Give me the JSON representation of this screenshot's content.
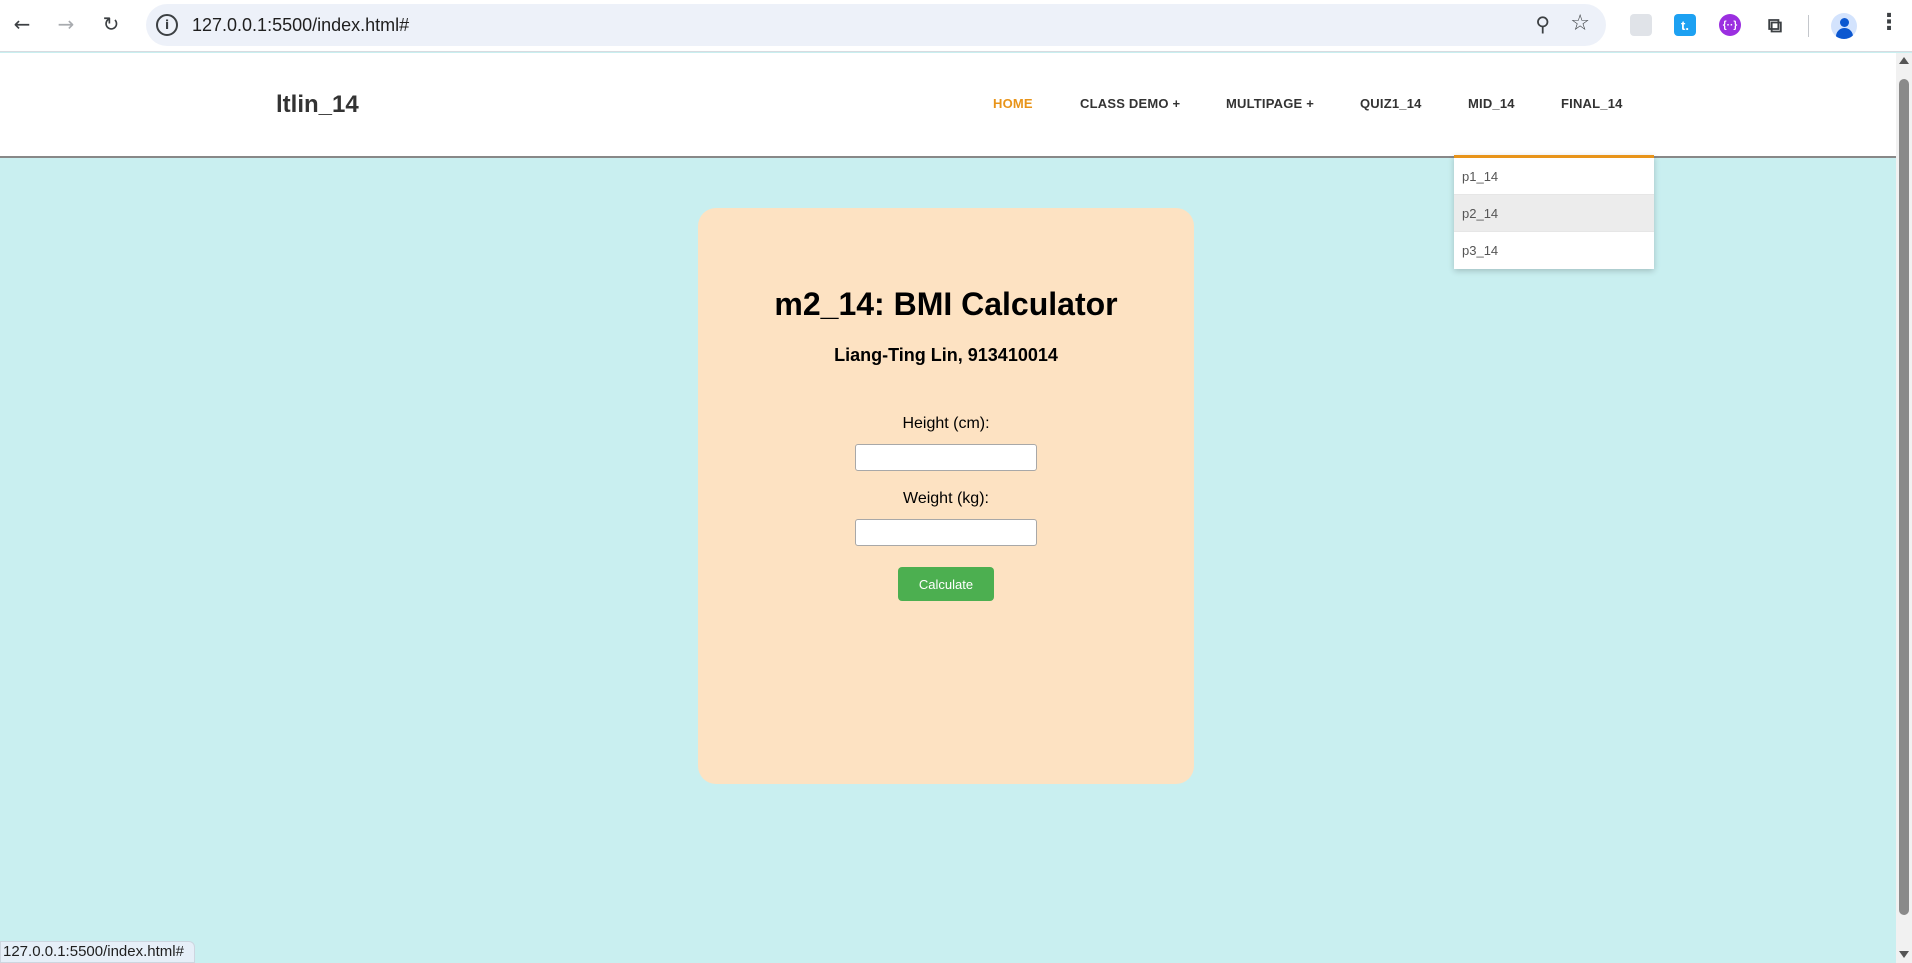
{
  "browser": {
    "url": "127.0.0.1:5500/index.html#",
    "status_url": "127.0.0.1:5500/index.html#",
    "extensions": [
      "generic-extension",
      "t-extension",
      "purple-extension"
    ],
    "extension_blue_letter": "t.",
    "extension_purple_glyph": "{··}"
  },
  "site": {
    "logo": "ltlin_14",
    "nav": [
      {
        "label": "HOME",
        "active": true
      },
      {
        "label": "CLASS DEMO +"
      },
      {
        "label": "MULTIPAGE +"
      },
      {
        "label": "QUIZ1_14"
      },
      {
        "label": "MID_14"
      },
      {
        "label": "FINAL_14"
      }
    ],
    "dropdown": [
      "p1_14",
      "p2_14",
      "p3_14"
    ],
    "accent_color": "#e8941a"
  },
  "card": {
    "title": "m2_14: BMI Calculator",
    "subtitle": "Liang-Ting Lin, 913410014",
    "height_label": "Height (cm):",
    "weight_label": "Weight (kg):",
    "height_value": "",
    "weight_value": "",
    "button_label": "Calculate",
    "background": "#fde2c2",
    "button_color": "#4caf50"
  },
  "page_background": "#c9eff0"
}
